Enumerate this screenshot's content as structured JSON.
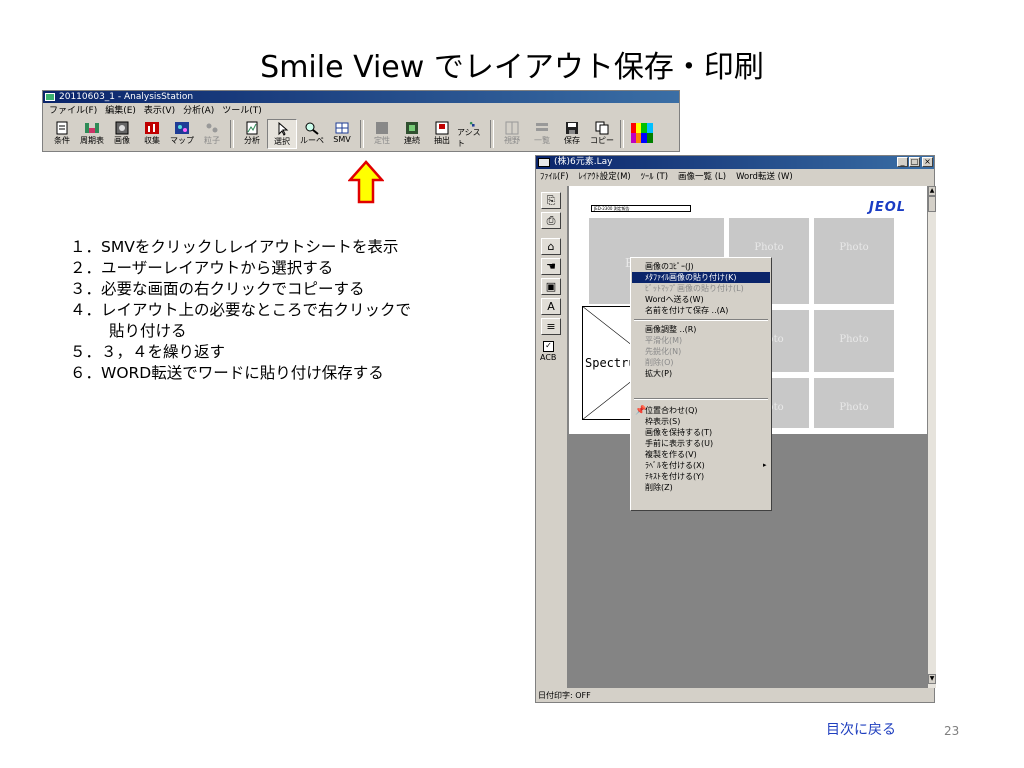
{
  "slide": {
    "title": "Smile View でレイアウト保存・印刷",
    "back_link": "目次に戻る",
    "page_number": "23"
  },
  "analysis_window": {
    "title": "20110603_1 - AnalysisStation",
    "menu": [
      "ファイル(F)",
      "編集(E)",
      "表示(V)",
      "分析(A)",
      "ツール(T)"
    ],
    "toolbar": [
      {
        "label": "条件",
        "icon": "conditions-icon",
        "disabled": false
      },
      {
        "label": "周期表",
        "icon": "periodic-table-icon",
        "disabled": false
      },
      {
        "label": "画像",
        "icon": "image-icon",
        "disabled": false
      },
      {
        "label": "収集",
        "icon": "collect-icon",
        "disabled": false
      },
      {
        "label": "マップ",
        "icon": "map-icon",
        "disabled": false
      },
      {
        "label": "粒子",
        "icon": "particle-icon",
        "disabled": true
      },
      {
        "label": "分析",
        "icon": "analysis-icon",
        "disabled": false
      },
      {
        "label": "選択",
        "icon": "select-cursor-icon",
        "disabled": false,
        "active": true
      },
      {
        "label": "ルーペ",
        "icon": "magnifier-icon",
        "disabled": false
      },
      {
        "label": "SMV",
        "icon": "smv-icon",
        "disabled": false
      },
      {
        "label": "定性",
        "icon": "qualitative-icon",
        "disabled": true
      },
      {
        "label": "連続",
        "icon": "continuous-icon",
        "disabled": false
      },
      {
        "label": "抽出",
        "icon": "extract-icon",
        "disabled": false
      },
      {
        "label": "アシスト",
        "icon": "assist-icon",
        "disabled": false
      },
      {
        "label": "視野",
        "icon": "field-view-icon",
        "disabled": true
      },
      {
        "label": "一覧",
        "icon": "list-icon",
        "disabled": true
      },
      {
        "label": "保存",
        "icon": "save-icon",
        "disabled": false
      },
      {
        "label": "コピー",
        "icon": "copy-icon",
        "disabled": false
      },
      {
        "label": "",
        "icon": "color-palette-icon",
        "disabled": false
      }
    ]
  },
  "steps": [
    "１．SMVをクリックしレイアウトシートを表示",
    "２．ユーザーレイアウトから選択する",
    "３．必要な画面の右クリックでコピーする",
    "４．レイアウト上の必要なところで右クリックで",
    "貼り付ける",
    "５．３，４を繰り返す",
    "６．WORD転送でワードに貼り付け保存する"
  ],
  "layout_window": {
    "title": "(株)6元素.Lay",
    "menu": [
      "ﾌｧｲﾙ(F)",
      "ﾚｲｱｳﾄ設定(M)",
      "ﾂｰﾙ (T)",
      "画像一覧 (L)",
      "Word転送 (W)"
    ],
    "sidebar_label": "ACB",
    "status": "日付印字: OFF",
    "header_text": "JED-2300 測定報告",
    "logo": "JEOL",
    "photo_label": "Photo",
    "spectrum_label": "Spectru",
    "partial_label": "E"
  },
  "context_menu": {
    "items": [
      {
        "label": "画像のｺﾋﾟｰ(J)",
        "state": "normal"
      },
      {
        "label": "ﾒﾀﾌｧｲﾙ画像の貼り付け(K)",
        "state": "selected"
      },
      {
        "label": "ﾋﾞｯﾄﾏｯﾌﾟ画像の貼り付け(L)",
        "state": "disabled"
      },
      {
        "label": "Wordへ送る(W)",
        "state": "normal"
      },
      {
        "label": "名前を付けて保存 ..(A)",
        "state": "normal"
      },
      {
        "label": "画像調整 ..(R)",
        "state": "normal"
      },
      {
        "label": "平滑化(M)",
        "state": "disabled"
      },
      {
        "label": "先鋭化(N)",
        "state": "disabled"
      },
      {
        "label": "削除(O)",
        "state": "disabled"
      },
      {
        "label": "拡大(P)",
        "state": "normal"
      },
      {
        "label": "位置合わせ(Q)",
        "state": "normal"
      },
      {
        "label": "枠表示(S)",
        "state": "normal"
      },
      {
        "label": "画像を保持する(T)",
        "state": "normal"
      },
      {
        "label": "手前に表示する(U)",
        "state": "normal"
      },
      {
        "label": "複製を作る(V)",
        "state": "normal"
      },
      {
        "label": "ﾗﾍﾞﾙを付ける(X)",
        "state": "normal"
      },
      {
        "label": "ﾃｷｽﾄを付ける(Y)",
        "state": "normal"
      },
      {
        "label": "削除(Z)",
        "state": "normal"
      }
    ]
  },
  "colors": {
    "titlebar_start": "#0a246a",
    "titlebar_end": "#3a6ea5",
    "arrow_fill": "#ffff00",
    "arrow_stroke": "#e00000",
    "link": "#1f3fbf",
    "jeol_logo": "#1a3cc4"
  }
}
